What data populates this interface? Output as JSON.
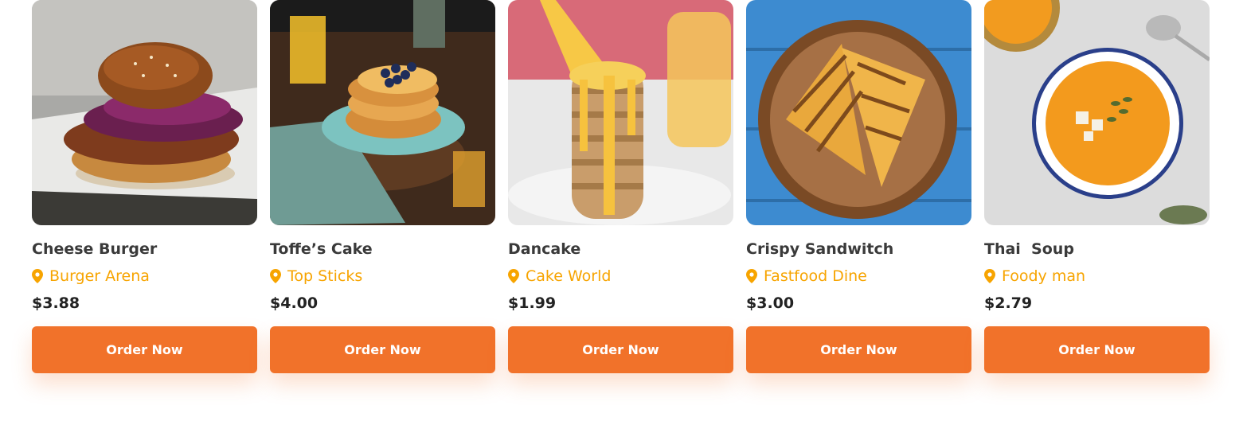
{
  "theme": {
    "accent": "#f1722a",
    "location_color": "#f7a400",
    "title_color": "#3a3a3a",
    "price_color": "#222222"
  },
  "products": [
    {
      "name": "Cheese Burger",
      "location": "Burger Arena",
      "price": "$3.88",
      "button": "Order Now",
      "icon": "location-pin-icon"
    },
    {
      "name": "Toffe’s Cake",
      "location": "Top Sticks",
      "price": "$4.00",
      "button": "Order Now",
      "icon": "location-pin-icon"
    },
    {
      "name": "Dancake",
      "location": "Cake World",
      "price": "$1.99",
      "button": "Order Now",
      "icon": "location-pin-icon"
    },
    {
      "name": "Crispy Sandwitch",
      "location": "Fastfood Dine",
      "price": "$3.00",
      "button": "Order Now",
      "icon": "location-pin-icon"
    },
    {
      "name": "Thai  Soup",
      "location": "Foody man",
      "price": "$2.79",
      "button": "Order Now",
      "icon": "location-pin-icon"
    }
  ]
}
